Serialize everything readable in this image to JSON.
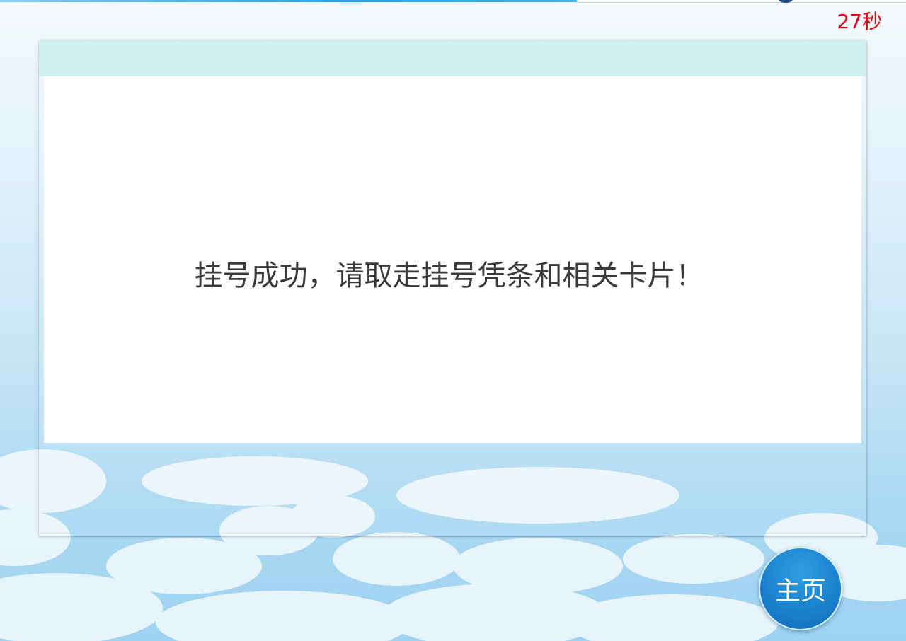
{
  "countdown": {
    "text": "27秒",
    "color": "#e60012"
  },
  "dialog": {
    "message": "挂号成功，请取走挂号凭条和相关卡片！",
    "header_color": "#cff1f0"
  },
  "home_button": {
    "label": "主页",
    "color": "#1b82cf"
  }
}
